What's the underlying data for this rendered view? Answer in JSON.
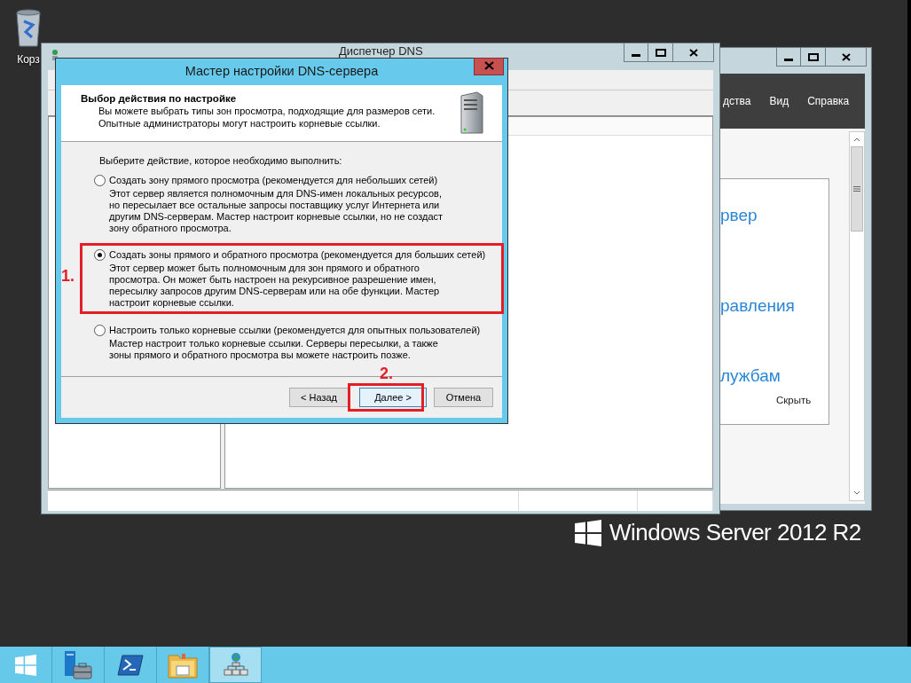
{
  "desktop": {
    "icons": [
      {
        "label": "Корз"
      }
    ],
    "brand": "Windows Server 2012 R2"
  },
  "server_manager": {
    "menu": [
      "дства",
      "Вид",
      "Справка"
    ],
    "links": [
      "рвер",
      "равления",
      "лужбам"
    ],
    "hide_link": "Скрыть"
  },
  "dns_manager": {
    "title": "Диспетчер DNS"
  },
  "wizard": {
    "title": "Мастер настройки DNS-сервера",
    "heading": "Выбор действия по настройке",
    "subtitle": [
      "Вы можете выбрать типы зон просмотра, подходящие для размеров сети.",
      "Опытные администраторы могут настроить корневые ссылки."
    ],
    "prompt": "Выберите действие, которое необходимо выполнить:",
    "options": [
      {
        "label": "Создать зону прямого просмотра (рекомендуется для небольших сетей)",
        "description": "Этот сервер является полномочным для DNS-имен локальных ресурсов, но пересылает все остальные запросы поставщику услуг Интернета или другим DNS-серверам. Мастер настроит корневые ссылки, но не создаст зону обратного просмотра.",
        "selected": false
      },
      {
        "label": "Создать зоны прямого и обратного просмотра (рекомендуется для больших сетей)",
        "description": "Этот сервер может быть полномочным для зон прямого и обратного просмотра. Он может быть настроен на рекурсивное разрешение имен, пересылку запросов другим DNS-серверам или на обе функции. Мастер настроит корневые ссылки.",
        "selected": true
      },
      {
        "label": "Настроить только корневые ссылки (рекомендуется для опытных пользователей)",
        "description": "Мастер настроит только корневые ссылки. Серверы пересылки, а также зоны прямого и обратного просмотра вы можете настроить позже.",
        "selected": false
      }
    ],
    "buttons": [
      {
        "label": "< Назад",
        "kind": "back"
      },
      {
        "label": "Далее >",
        "kind": "next"
      },
      {
        "label": "Отмена",
        "kind": "cancel"
      }
    ]
  },
  "annotations": [
    {
      "label": "1."
    },
    {
      "label": "2."
    }
  ],
  "taskbar": {
    "items": [
      {
        "kind": "start",
        "selected": false
      },
      {
        "kind": "server-manager",
        "selected": false
      },
      {
        "kind": "powershell",
        "selected": false
      },
      {
        "kind": "explorer",
        "selected": false
      },
      {
        "kind": "dns",
        "selected": true
      }
    ]
  }
}
